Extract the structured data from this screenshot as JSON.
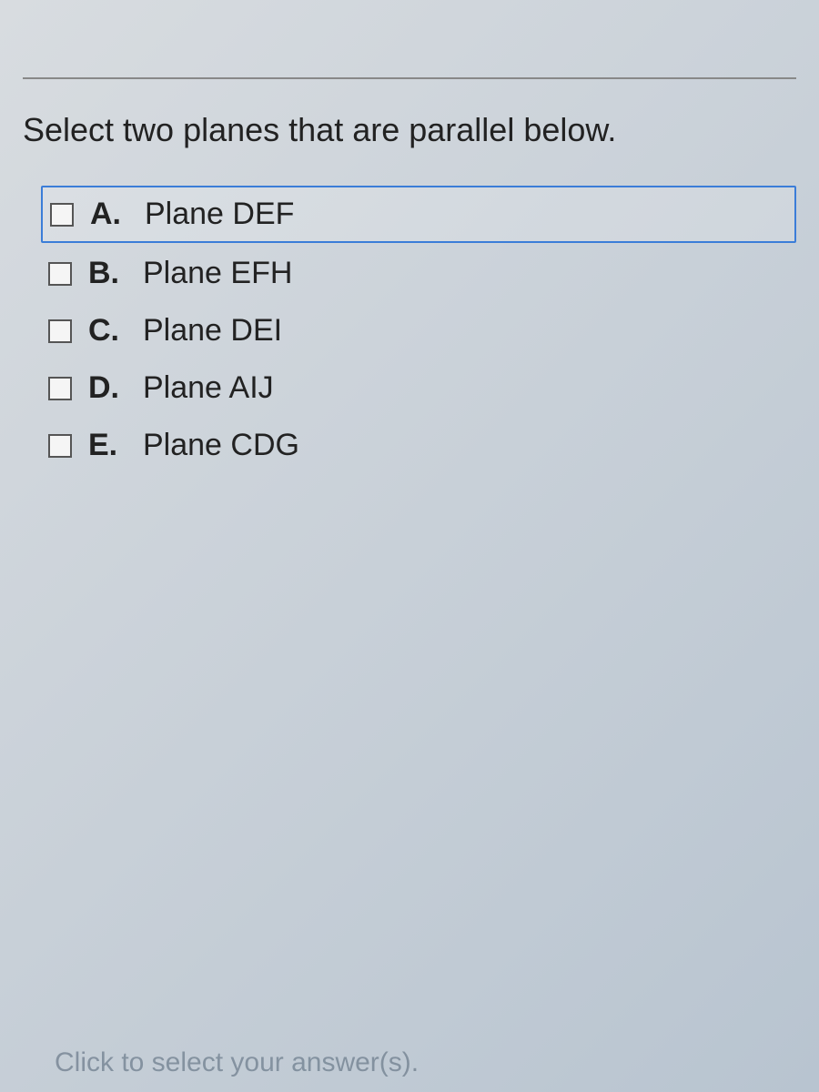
{
  "question": {
    "prompt": "Select two planes that are parallel below."
  },
  "options": [
    {
      "letter": "A.",
      "text": "Plane DEF",
      "highlighted": true
    },
    {
      "letter": "B.",
      "text": "Plane EFH",
      "highlighted": false
    },
    {
      "letter": "C.",
      "text": "Plane DEI",
      "highlighted": false
    },
    {
      "letter": "D.",
      "text": "Plane AIJ",
      "highlighted": false
    },
    {
      "letter": "E.",
      "text": "Plane CDG",
      "highlighted": false
    }
  ],
  "footer": {
    "hint": "Click to select your answer(s)."
  }
}
